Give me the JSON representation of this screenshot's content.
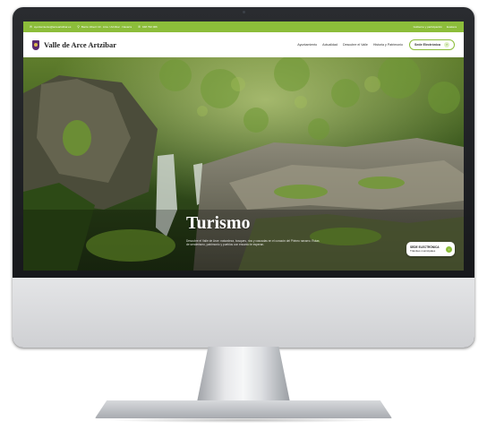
{
  "website": {
    "topbar": {
      "email": "ayuntamiento@arcearistibar.es",
      "address": "Barrio Iriberri 10 · Arce / Artzibar · Navarra",
      "phone": "948 790 006",
      "participation_link": "Gobierno y participación",
      "language": "Euskera"
    },
    "header": {
      "site_title": "Valle de Arce Artzibar",
      "nav": [
        "Ayuntamiento",
        "Actualidad",
        "Descubre el Valle",
        "Historia y Patrimonio"
      ],
      "sede_button": "Sede Electrónica"
    },
    "hero": {
      "title": "Turismo",
      "text": "Descubre el Valle de Arce: naturaleza, bosques, ríos y cascadas en el corazón del Pirineo navarro. Rutas de senderismo, patrimonio y pueblos con encanto te esperan.",
      "sede_card_title": "SEDE ELECTRÓNICA",
      "sede_card_subtitle": "Trámites municipales"
    }
  },
  "icons": {
    "email": "envelope-icon",
    "address": "location-pin-icon",
    "phone": "phone-icon",
    "arrow": "arrow-right-icon"
  },
  "colors": {
    "accent_green": "#8cbd3a",
    "shield_purple": "#5b2a6e",
    "monitor_bezel": "#16171a"
  }
}
